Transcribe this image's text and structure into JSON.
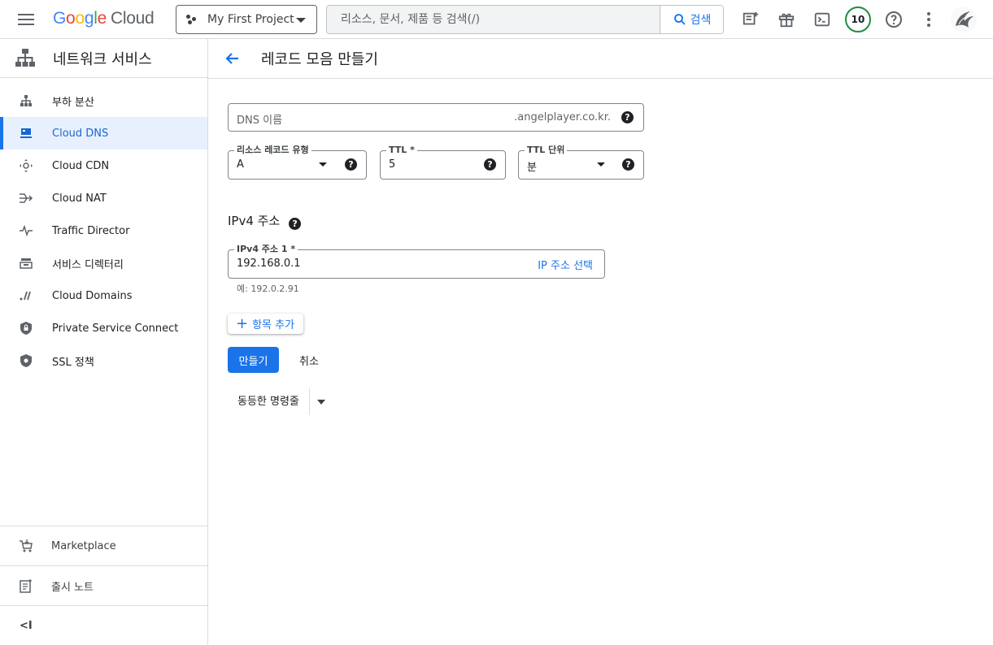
{
  "topbar": {
    "logo": {
      "g1": "G",
      "g2": "o",
      "g3": "o",
      "g4": "g",
      "g5": "l",
      "g6": "e",
      "cloud": "Cloud"
    },
    "project": "My First Project",
    "search": {
      "placeholder": "리소스, 문서, 제품 등 검색(/)",
      "button": "검색"
    },
    "notification_count": "10"
  },
  "sidebar": {
    "title": "네트워크 서비스",
    "items": [
      {
        "label": "부하 분산",
        "icon": "load-balancing-icon"
      },
      {
        "label": "Cloud DNS",
        "icon": "dns-icon",
        "active": true
      },
      {
        "label": "Cloud CDN",
        "icon": "cdn-icon"
      },
      {
        "label": "Cloud NAT",
        "icon": "nat-icon"
      },
      {
        "label": "Traffic Director",
        "icon": "traffic-icon"
      },
      {
        "label": "서비스 디렉터리",
        "icon": "directory-icon"
      },
      {
        "label": "Cloud Domains",
        "icon": "domains-icon"
      },
      {
        "label": "Private Service Connect",
        "icon": "lock-icon"
      },
      {
        "label": "SSL 정책",
        "icon": "shield-icon"
      }
    ],
    "bottom": {
      "marketplace": "Marketplace",
      "release_notes": "출시 노트",
      "collapse": "<I"
    }
  },
  "main": {
    "title": "레코드 모음 만들기",
    "dns_name": {
      "placeholder": "DNS 이름",
      "suffix": ".angelplayer.co.kr."
    },
    "record_type": {
      "label": "리소스 레코드 유형",
      "value": "A"
    },
    "ttl": {
      "label": "TTL *",
      "value": "5"
    },
    "ttl_unit": {
      "label": "TTL 단위",
      "value": "분"
    },
    "ipv4_section": "IPv4 주소",
    "ipv4_field": {
      "label": "IPv4 주소 1 *",
      "value": "192.168.0.1",
      "action": "IP 주소 선택"
    },
    "ipv4_hint": "예: 192.0.2.91",
    "add_item": "항목 추가",
    "create": "만들기",
    "cancel": "취소",
    "equivalent": "동등한 명령줄"
  },
  "colors": {
    "accent": "#1a73e8",
    "active_bg": "#e8f0fe",
    "badge_ring": "#1e8e3e"
  }
}
